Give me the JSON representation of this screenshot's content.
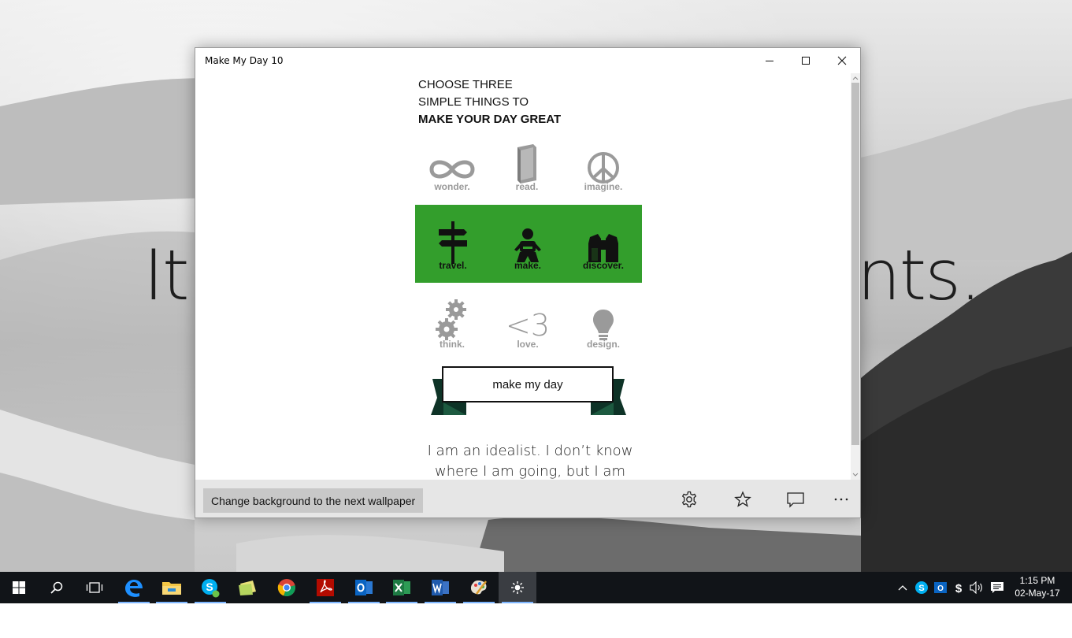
{
  "desktop": {
    "bg_text_left": "It",
    "bg_text_right": "nts."
  },
  "window": {
    "title": "Make My Day 10"
  },
  "heading": {
    "line1": "CHOOSE THREE",
    "line2": "SIMPLE THINGS TO",
    "line3": "MAKE YOUR DAY GREAT"
  },
  "tiles": [
    {
      "label": "wonder.",
      "icon": "infinity-icon",
      "selected": false
    },
    {
      "label": "read.",
      "icon": "book-icon",
      "selected": false
    },
    {
      "label": "imagine.",
      "icon": "peace-icon",
      "selected": false
    },
    {
      "label": "travel.",
      "icon": "signpost-icon",
      "selected": true
    },
    {
      "label": "make.",
      "icon": "baby-icon",
      "selected": true
    },
    {
      "label": "discover.",
      "icon": "binoculars-icon",
      "selected": true
    },
    {
      "label": "think.",
      "icon": "gears-icon",
      "selected": false
    },
    {
      "label": "love.",
      "icon": "heart-text-icon",
      "selected": false
    },
    {
      "label": "design.",
      "icon": "lightbulb-icon",
      "selected": false
    }
  ],
  "love_icon_text": "<3",
  "make_button": "make my day",
  "quote": {
    "line1": "I am an idealist. I don’t know",
    "line2": "where I am going, but I am"
  },
  "appbar": {
    "bg_button": "Change background to the next wallpaper",
    "icons": [
      "settings-icon",
      "star-icon",
      "comment-icon",
      "more-icon"
    ]
  },
  "colors": {
    "accent_green": "#339e2c",
    "tile_gray": "#9a9a9a",
    "ribbon_dark": "#0e3327"
  },
  "taskbar": {
    "apps": [
      "start-icon",
      "search-icon",
      "task-view-icon",
      "edge-icon",
      "file-explorer-icon",
      "skype-icon",
      "sticky-notes-icon",
      "chrome-icon",
      "acrobat-icon",
      "outlook-icon",
      "excel-icon",
      "word-icon",
      "paint-icon",
      "make-my-day-icon"
    ],
    "time": "1:15 PM",
    "date": "02-May-17"
  }
}
